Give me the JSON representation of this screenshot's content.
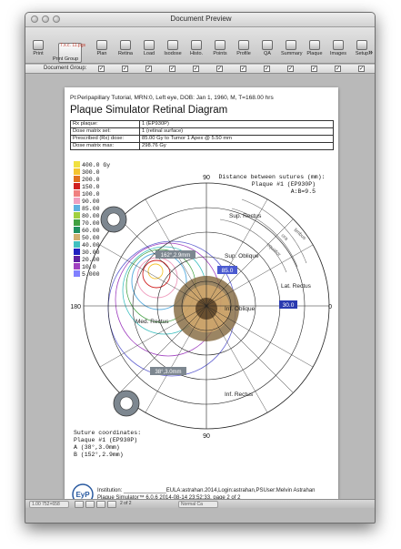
{
  "window": {
    "title": "Document Preview"
  },
  "toolbar": {
    "print_label": "Print",
    "print_group_label": "Print Group",
    "print_group_tag": "7.x.c. 11.pgs",
    "buttons": [
      "Plan",
      "Retina",
      "Load",
      "Isodose",
      "Histo.",
      "Points",
      "Profile",
      "QA",
      "Summary",
      "Plaque",
      "Images",
      "Setup"
    ],
    "overflow": "»"
  },
  "document_group": {
    "label": "Document Group:",
    "checked": [
      true,
      true,
      true,
      true,
      true,
      true,
      true,
      true,
      true,
      true,
      true,
      true
    ]
  },
  "page": {
    "patient_line": "Pt:Peripapillary Tutorial, MRN:0, Left eye, DOB: Jan 1, 1960, M, T=168.00 hrs",
    "heading": "Plaque Simulator Retinal Diagram",
    "info_rows": [
      {
        "label": "Rx plaque:",
        "value": "1 (EP930P)"
      },
      {
        "label": "Dose matrix set:",
        "value": "1 (retinal surface)"
      },
      {
        "label": "Prescribed (Rx) dose:",
        "value": "85.00  Gy to Tumor 1 Apex @ 5.50 mm"
      },
      {
        "label": "Dose matrix max:",
        "value": "298.76  Gy"
      }
    ],
    "legend": [
      {
        "label": "400.0 Gy",
        "color": "#f0e040"
      },
      {
        "label": "300.0",
        "color": "#f4c430"
      },
      {
        "label": "200.0",
        "color": "#e07020"
      },
      {
        "label": "150.0",
        "color": "#d02020"
      },
      {
        "label": "100.0",
        "color": "#f08080"
      },
      {
        "label": "90.00",
        "color": "#f0a0c0"
      },
      {
        "label": "85.00",
        "color": "#60b0e0"
      },
      {
        "label": "80.00",
        "color": "#a0d040"
      },
      {
        "label": "70.00",
        "color": "#40a040"
      },
      {
        "label": "60.00",
        "color": "#209060"
      },
      {
        "label": "50.00",
        "color": "#d0b070"
      },
      {
        "label": "40.00",
        "color": "#40c0c0"
      },
      {
        "label": "30.00",
        "color": "#2020c0"
      },
      {
        "label": "20.00",
        "color": "#6020a0"
      },
      {
        "label": "10.0",
        "color": "#a040c0"
      },
      {
        "label": "5.000",
        "color": "#8080ff"
      }
    ],
    "suture_header": "Distance between sutures (mm):",
    "suture_plaque": "Plaque #1 (EP930P)",
    "suture_ab": "A:B=9.5",
    "angle_labels": {
      "top": "90",
      "bottom": "90",
      "left": "180",
      "right": "0"
    },
    "region_labels": [
      "Sup. Rectus",
      "Sup. Oblique",
      "Lat. Rectus",
      "Inf. Rectus",
      "Med. Rectus",
      "Inf. Oblique"
    ],
    "outer_labels": [
      "limbus",
      "ora",
      "equator"
    ],
    "tag_85": "85.0",
    "tag_30": "30.0",
    "tag_a": "162°,2.9mm",
    "tag_b": "38°,3.0mm",
    "suture_coords_title": "Suture coordinates:",
    "suture_coords_plaque": "Plaque #1 (EP930P)",
    "suture_a": "A (38°,3.0mm)",
    "suture_b": "B (152°,2.9mm)",
    "footer_line1": "Institution: ______________EULA:astrahan.2014,Login:astrahan,PSUser:Melvin Astrahan",
    "footer_line2": "Plaque Simulator™ 6.0.6 2014-08-14 23:52:33, page 2 of 2",
    "logo_text": "EyP"
  },
  "statusbar": {
    "dimensions": "1.00 752×658",
    "page_indicator": "2 of 2",
    "zoom": "Normal Ca"
  },
  "colors": {
    "window_bg": "#b9b9b9",
    "toolbar_gradient_top": "#e3e3e3",
    "toolbar_gradient_bottom": "#c4c4c4",
    "plaque_fill": "#8a7048",
    "tumor_fill": "#e0b070"
  }
}
